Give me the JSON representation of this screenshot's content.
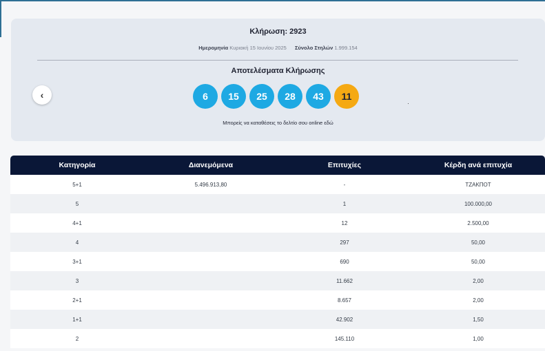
{
  "draw": {
    "title": "Κλήρωση: 2923",
    "date_label": "Ημερομηνία",
    "date_value": "Κυριακή 15 Ιουνίου 2025",
    "columns_label": "Σύνολο Στηλών",
    "columns_value": "1.999.154",
    "results_title": "Αποτελέσματα Κλήρωσης",
    "prev_button": "‹",
    "numbers": [
      "6",
      "15",
      "25",
      "28",
      "43"
    ],
    "bonus": "11",
    "online_note": "Μπορείς να καταθέσεις το δελτίο σου online εδώ"
  },
  "table": {
    "headers": [
      "Κατηγορία",
      "Διανεμόμενα",
      "Επιτυχίες",
      "Κέρδη ανά επιτυχία"
    ],
    "rows": [
      [
        "5+1",
        "5.496.913,80",
        "-",
        "ΤΖΑΚΠΟΤ"
      ],
      [
        "5",
        "",
        "1",
        "100.000,00"
      ],
      [
        "4+1",
        "",
        "12",
        "2.500,00"
      ],
      [
        "4",
        "",
        "297",
        "50,00"
      ],
      [
        "3+1",
        "",
        "690",
        "50,00"
      ],
      [
        "3",
        "",
        "11.662",
        "2,00"
      ],
      [
        "2+1",
        "",
        "8.657",
        "2,00"
      ],
      [
        "1+1",
        "",
        "42.902",
        "1,50"
      ],
      [
        "2",
        "",
        "145.110",
        "1,00"
      ]
    ]
  },
  "colors": {
    "ball": "#1ea9e3",
    "bonus_ball": "#f5a913",
    "table_header": "#0a1737",
    "card": "#e4e9f0"
  }
}
